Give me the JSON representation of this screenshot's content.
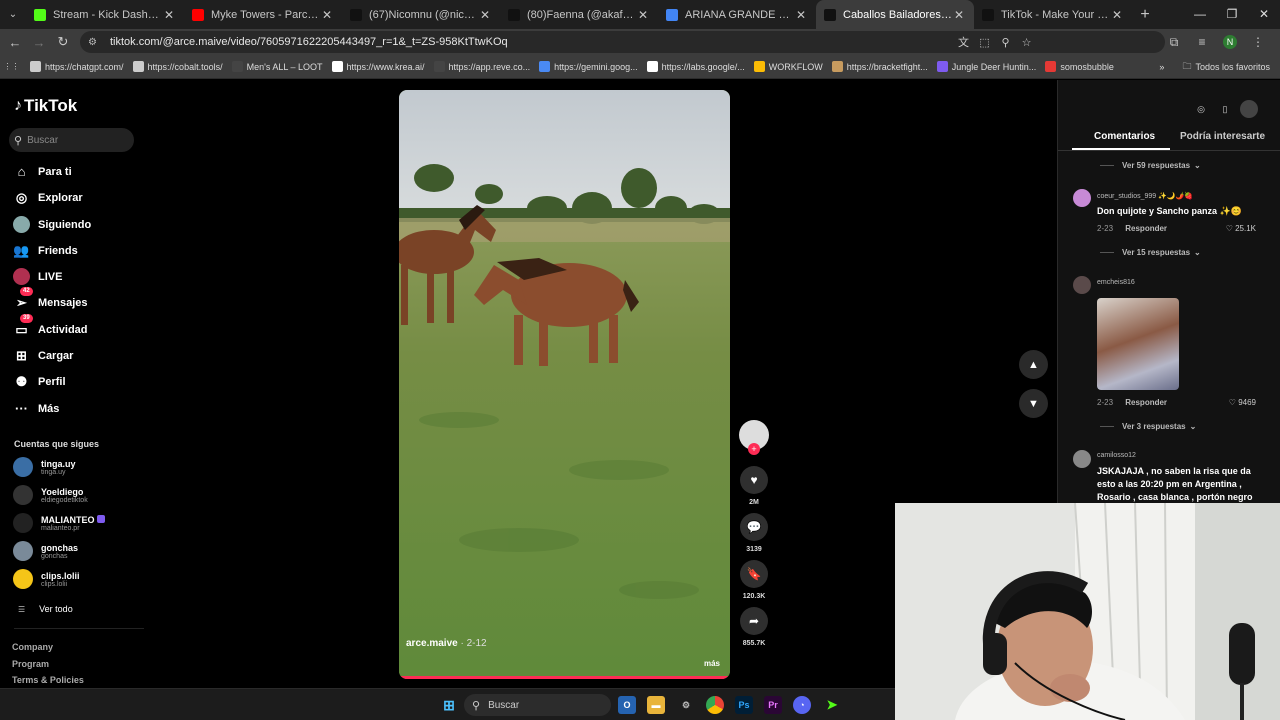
{
  "browser": {
    "tabs": [
      {
        "title": "Stream - Kick Dashboard",
        "color": "#53fc18"
      },
      {
        "title": "Myke Towers - Parcerita (Audio",
        "color": "#ff0000"
      },
      {
        "title": "(67)Nicomnu (@nicomnu) | TikT",
        "color": "#111111"
      },
      {
        "title": "(80)Faenna (@akafaenna) | TikT",
        "color": "#111111"
      },
      {
        "title": "ARIANA GRANDE EDAD - Busca",
        "color": "#4285f4"
      },
      {
        "title": "Caballos Bailadores: Risas y Me",
        "color": "#111111",
        "active": true
      },
      {
        "title": "TikTok - Make Your Day",
        "color": "#111111"
      }
    ],
    "url": "tiktok.com/@arce.maive/video/7605971622205443497_r=1&_t=ZS-958KtTtwKOq",
    "profile_initial": "N",
    "bookmarks": [
      "https://chatgpt.com/",
      "https://cobalt.tools/",
      "Men's ALL – LOOT",
      "https://www.krea.ai/",
      "https://app.reve.co...",
      "https://gemini.goog...",
      "https://labs.google/...",
      "WORKFLOW",
      "https://bracketfight...",
      "Jungle Deer Huntin...",
      "somosbubble"
    ],
    "bookmarks_folder": "Todos los favoritos"
  },
  "tiktok": {
    "logo": "TikTok",
    "search_placeholder": "Buscar",
    "nav": [
      {
        "label": "Para ti"
      },
      {
        "label": "Explorar"
      },
      {
        "label": "Siguiendo"
      },
      {
        "label": "Friends"
      },
      {
        "label": "LIVE"
      },
      {
        "label": "Mensajes",
        "badge": "42"
      },
      {
        "label": "Actividad",
        "badge": "39"
      },
      {
        "label": "Cargar"
      },
      {
        "label": "Perfil"
      },
      {
        "label": "Más"
      }
    ],
    "following_title": "Cuentas que sigues",
    "following": [
      {
        "name": "tinga.uy",
        "handle": "tinga.uy",
        "color": "#3a6ea5"
      },
      {
        "name": "Yoeldiego",
        "handle": "eldiegodetiktok",
        "color": "#333333"
      },
      {
        "name": "MALIANTEO",
        "handle": "malianteo.pr",
        "color": "#222222",
        "verified": true
      },
      {
        "name": "gonchas",
        "handle": "gonchas",
        "color": "#7a8a99"
      },
      {
        "name": "clips.lolii",
        "handle": "clips.lolii",
        "color": "#f5c518"
      }
    ],
    "see_all": "Ver todo",
    "footer": [
      "Company",
      "Program",
      "Terms & Policies"
    ],
    "video": {
      "author": "arce.maive",
      "date": "· 2-12",
      "more": "más"
    },
    "actions": {
      "likes": "2M",
      "comments": "3139",
      "saves": "120.3K",
      "shares": "855.7K"
    },
    "panel": {
      "tabs": [
        "Comentarios",
        "Podría interesarte"
      ],
      "comments": [
        {
          "replies_above": "Ver 59 respuestas"
        },
        {
          "user": "coeur_studios_999 ✨🌙🌶️🍓",
          "text": "Don quijote y Sancho panza ✨😊",
          "date": "2-23",
          "reply": "Responder",
          "likes": "25.1K",
          "replies": "Ver 15 respuestas",
          "avatar_color": "#c78ad6"
        },
        {
          "user": "emcheis816",
          "text": "",
          "date": "2-23",
          "reply": "Responder",
          "likes": "9469",
          "replies": "Ver 3 respuestas",
          "avatar_color": "#5a4a4a"
        },
        {
          "user": "camilosso12",
          "text": "JSKAJAJA , no saben la risa que da esto a las 20:20 pm en Argentina , Rosario , casa blanca , portón negro",
          "avatar_color": "#888888"
        }
      ]
    }
  },
  "taskbar": {
    "search": "Buscar"
  }
}
